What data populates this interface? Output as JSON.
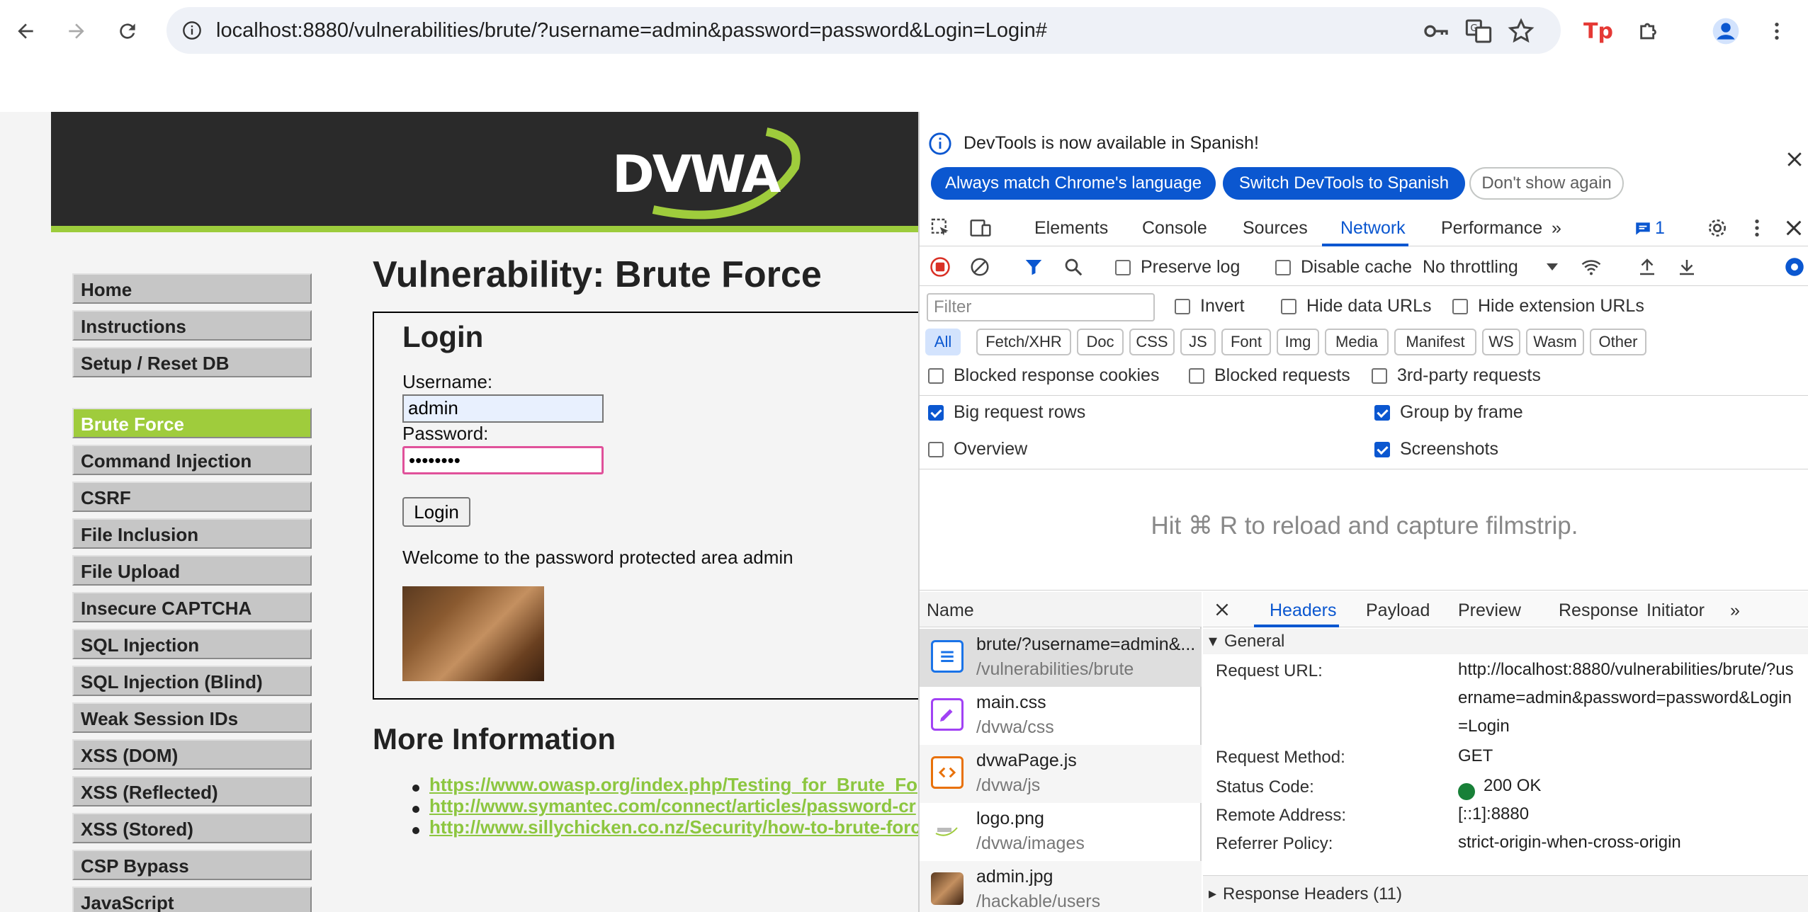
{
  "browser": {
    "url": "localhost:8880/vulnerabilities/brute/?username=admin&password=password&Login=Login#"
  },
  "dvwa": {
    "logo_text": "DVWA",
    "menu": [
      {
        "label": "Home"
      },
      {
        "label": "Instructions"
      },
      {
        "label": "Setup / Reset DB"
      },
      {
        "label": "Brute Force"
      },
      {
        "label": "Command Injection"
      },
      {
        "label": "CSRF"
      },
      {
        "label": "File Inclusion"
      },
      {
        "label": "File Upload"
      },
      {
        "label": "Insecure CAPTCHA"
      },
      {
        "label": "SQL Injection"
      },
      {
        "label": "SQL Injection (Blind)"
      },
      {
        "label": "Weak Session IDs"
      },
      {
        "label": "XSS (DOM)"
      },
      {
        "label": "XSS (Reflected)"
      },
      {
        "label": "XSS (Stored)"
      },
      {
        "label": "CSP Bypass"
      },
      {
        "label": "JavaScript"
      }
    ],
    "title": "Vulnerability: Brute Force",
    "login": {
      "heading": "Login",
      "username_label": "Username:",
      "username_value": "admin",
      "password_label": "Password:",
      "password_value": "••••••••",
      "button": "Login",
      "welcome": "Welcome to the password protected area admin"
    },
    "more_info_title": "More Information",
    "links": [
      "https://www.owasp.org/index.php/Testing_for_Brute_Fo",
      "http://www.symantec.com/connect/articles/password-cr",
      "http://www.sillychicken.co.nz/Security/how-to-brute-forc"
    ]
  },
  "devtools": {
    "banner": {
      "text": "DevTools is now available in Spanish!",
      "btn_match": "Always match Chrome's language",
      "btn_switch": "Switch DevTools to Spanish",
      "btn_dont_show": "Don't show again"
    },
    "tabs": [
      "Elements",
      "Console",
      "Sources",
      "Network",
      "Performance"
    ],
    "issues_count": "1",
    "toolbar": {
      "preserve_log": "Preserve log",
      "disable_cache": "Disable cache",
      "throttling": "No throttling"
    },
    "filter": {
      "placeholder": "Filter",
      "invert": "Invert",
      "hide_data_urls": "Hide data URLs",
      "hide_ext_urls": "Hide extension URLs"
    },
    "type_chips": [
      "All",
      "Fetch/XHR",
      "Doc",
      "CSS",
      "JS",
      "Font",
      "Img",
      "Media",
      "Manifest",
      "WS",
      "Wasm",
      "Other"
    ],
    "options": {
      "blocked_cookies": "Blocked response cookies",
      "blocked_requests": "Blocked requests",
      "third_party": "3rd-party requests",
      "big_rows": "Big request rows",
      "group_by_frame": "Group by frame",
      "overview": "Overview",
      "screenshots": "Screenshots"
    },
    "filmstrip_hint": "Hit ⌘ R to reload and capture filmstrip.",
    "name_header": "Name",
    "requests": [
      {
        "name": "brute/?username=admin&...",
        "path": "/vulnerabilities/brute"
      },
      {
        "name": "main.css",
        "path": "/dvwa/css"
      },
      {
        "name": "dvwaPage.js",
        "path": "/dvwa/js"
      },
      {
        "name": "logo.png",
        "path": "/dvwa/images"
      },
      {
        "name": "admin.jpg",
        "path": "/hackable/users"
      }
    ],
    "detail_tabs": [
      "Headers",
      "Payload",
      "Preview",
      "Response",
      "Initiator"
    ],
    "general": {
      "title": "General",
      "request_url_key": "Request URL:",
      "request_url_val": "http://localhost:8880/vulnerabilities/brute/?username=admin&password=password&Login=Login",
      "method_key": "Request Method:",
      "method_val": "GET",
      "status_key": "Status Code:",
      "status_val": "200 OK",
      "remote_key": "Remote Address:",
      "remote_val": "[::1]:8880",
      "referrer_key": "Referrer Policy:",
      "referrer_val": "strict-origin-when-cross-origin"
    },
    "response_headers": "Response Headers (11)"
  },
  "colors": {
    "accent": "#0b57d0",
    "dvwa_green": "#9fcc3c",
    "status_ok": "#188038"
  }
}
